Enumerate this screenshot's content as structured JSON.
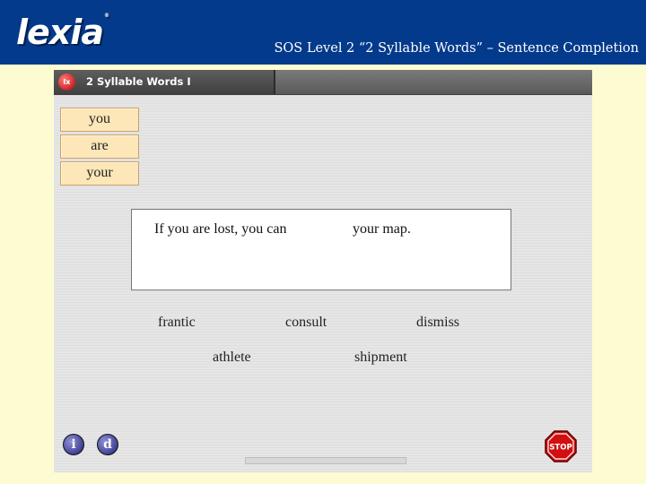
{
  "banner": {
    "logo": "lexia",
    "logo_mark": "®",
    "slide_title": "SOS Level 2 “2 Syllable Words” – Sentence Completion"
  },
  "window": {
    "title": "2 Syllable Words I",
    "app_icon_label": "lx"
  },
  "word_tiles": [
    "you",
    "are",
    "your"
  ],
  "sentence": {
    "before_blank": "If you are lost, you can",
    "after_blank": "your map."
  },
  "choices": [
    "frantic",
    "consult",
    "dismiss",
    "athlete",
    "shipment"
  ],
  "controls": {
    "info_label": "i",
    "dictionary_label": "d",
    "stop_label": "STOP"
  },
  "colors": {
    "banner": "#043a8c",
    "page_background": "#fdfbd2",
    "tile": "#fde6b8",
    "stop": "#d01010"
  }
}
